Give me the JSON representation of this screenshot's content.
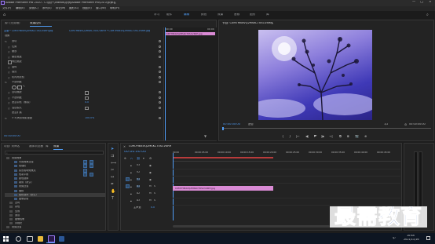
{
  "window": {
    "title": "Adobe Premiere Pro 2020 - C:\\用户\\Videos\\示例\\Adobe Premiere Pro\\14.0\\未命名",
    "controls": [
      "—",
      "□",
      "✕"
    ]
  },
  "menu": [
    "文件(F)",
    "编辑(E)",
    "剪辑(C)",
    "序列(S)",
    "标记(M)",
    "图形(G)",
    "视图(V)",
    "窗口(W)",
    "帮助(H)"
  ],
  "workspaces": [
    "学习",
    "组件",
    "编辑",
    "颜色",
    "效果",
    "音频",
    "图形",
    "库"
  ],
  "workspace_active": "编辑",
  "effect_controls": {
    "tabs": [
      "源: (无剪辑)",
      "效果控件"
    ],
    "active_tab": "效果控件",
    "source_line": "主要 * C0M7HB4VQ2MSKCT0SCV4RH.jpg",
    "sequence_line": "C0M7HB4VQ2MSKCT0SCV4RH * C0M7HB4VQ2MSKCT0SCV4RH.jpg",
    "section": "视频",
    "rows": [
      {
        "label": "运动",
        "value": "",
        "indent": 0
      },
      {
        "label": "位置",
        "value": "",
        "indent": 1
      },
      {
        "label": "缩放",
        "value": "",
        "indent": 1
      },
      {
        "label": "缩放宽度",
        "value": "",
        "indent": 1
      },
      {
        "label": "等比缩放",
        "value": "",
        "indent": 1
      },
      {
        "label": "旋转",
        "value": "",
        "indent": 1
      },
      {
        "label": "描点",
        "value": "",
        "indent": 1
      },
      {
        "label": "防闪烁滤镜",
        "value": "",
        "indent": 1
      },
      {
        "label": "不透明度",
        "value": "",
        "indent": 0
      },
      {
        "label": "",
        "value": "",
        "indent": 1
      },
      {
        "label": "自动播放",
        "value": "",
        "indent": 1
      },
      {
        "label": "不透明度",
        "value": "",
        "indent": 1
      },
      {
        "label": "遮罩羽化（像素）",
        "value": "0.0",
        "indent": 1
      },
      {
        "label": "混合模式",
        "value": "",
        "indent": 1
      },
      {
        "label": "遮罩扩展",
        "value": "",
        "indent": 1
      },
      {
        "label": "> 时间重映射速度",
        "value": "100.0%",
        "indent": 1
      }
    ],
    "timecode": "00:00:00:00",
    "mini_timeline_start": "00:00",
    "mini_timeline_end": "00:00",
    "mini_clip": "C0M7HB4VQ2MSKCT0SCV4RH.jpg"
  },
  "program_monitor": {
    "tab": "节目: C0M7HB4VQ2MSKCT0SCV4RH",
    "timecode_current": "00:00:00:00",
    "fit": "适合",
    "timecode_total": "00:00:00:00",
    "quality": "1/2",
    "buttons": [
      "{",
      "}",
      "|←",
      "◀|",
      "▶",
      "|▶",
      "→|",
      "⧉",
      "⧈",
      "📷",
      "⊕"
    ]
  },
  "project_panel": {
    "tabs": [
      "项目: 未命名",
      "媒体浏览器",
      "库",
      "效果"
    ],
    "active_tab": "效果",
    "search_placeholder": "",
    "items": [
      {
        "label": "视频效果",
        "indent": 0
      },
      {
        "label": "光照效果过渡",
        "indent": 2
      },
      {
        "label": "纹理化",
        "indent": 2
      },
      {
        "label": "投影照明效果点",
        "indent": 2
      },
      {
        "label": "色彩平衡",
        "indent": 2
      },
      {
        "label": "颜色替换",
        "indent": 2
      },
      {
        "label": "裁剪（默认）",
        "indent": 2
      },
      {
        "label": "视频过渡",
        "indent": 2
      },
      {
        "label": "偏移",
        "indent": 2
      },
      {
        "label": "随机块阵（默认）",
        "indent": 2
      },
      {
        "label": "图像蒙版",
        "indent": 2
      },
      {
        "label": "过时",
        "indent": 1
      },
      {
        "label": "杂色",
        "indent": 1
      },
      {
        "label": "生成",
        "indent": 1
      },
      {
        "label": "通道",
        "indent": 1
      },
      {
        "label": "图像控制",
        "indent": 1
      },
      {
        "label": "风格化",
        "indent": 1
      },
      {
        "label": "视频过渡",
        "indent": 0
      }
    ]
  },
  "timeline": {
    "tab": "C0M7HB4VQ2MSKCT0SCV4RH",
    "timecode": "00:00:00:00",
    "ruler": [
      "00:00",
      "00:00:05:00",
      "00:00:10:00",
      "00:00:15:00",
      "00:00:20:00",
      "00:00:25:00",
      "00:00:30:00",
      "00:00:35:00",
      "00:00:40:00",
      "00:00:45:00"
    ],
    "tracks": [
      "V3",
      "V2",
      "V1",
      "A1",
      "A2",
      "A3"
    ],
    "master": "主声道",
    "master_value": "0.0",
    "clip_label": "C0M7HB4VQ2MSKCT0SCV4RH.jpg",
    "clip_color": "#d98ad4"
  },
  "watermark": "最需教育",
  "taskbar": {
    "time": "10:44",
    "date": "2021/11/16",
    "lang": "中"
  },
  "colors": {
    "accent": "#4f9cf5",
    "clip": "#d98ad4",
    "playhead": "#4f9cf5",
    "watermark": "#1f4fb5"
  }
}
